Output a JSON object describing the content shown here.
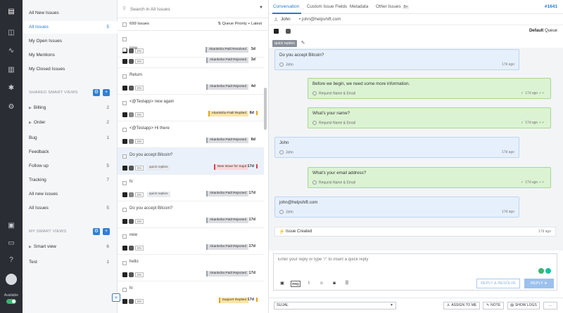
{
  "rail": {
    "available_label": "Available"
  },
  "views": {
    "top_items": [
      {
        "label": "All New Issues",
        "count": ""
      },
      {
        "label": "All Issues",
        "count": "5"
      },
      {
        "label": "My Open Issues",
        "count": ""
      },
      {
        "label": "My Mentions",
        "count": ""
      },
      {
        "label": "My Closed Issues",
        "count": ""
      }
    ],
    "shared_title": "SHARED SMART VIEWS",
    "shared_items": [
      {
        "label": "Billing",
        "count": "2"
      },
      {
        "label": "Order",
        "count": "2"
      },
      {
        "label": "Bug",
        "count": "1"
      },
      {
        "label": "Feedback",
        "count": ""
      },
      {
        "label": "Follow up",
        "count": "5"
      },
      {
        "label": "Tracking",
        "count": "7"
      },
      {
        "label": "All new issues",
        "count": ""
      },
      {
        "label": "All Issues",
        "count": "5"
      }
    ],
    "my_title": "MY SMART VIEWS",
    "my_items": [
      {
        "label": "Smart view",
        "count": "6"
      },
      {
        "label": "Test",
        "count": "1"
      }
    ]
  },
  "issues": {
    "search_placeholder": "Search in All Issues",
    "total_label": "699 Issues",
    "sort_label": "Queue Priority + Latest",
    "en_tag": "EN",
    "items": [
      {
        "title": "",
        "tag": "",
        "assignee": "Akanksha Patil Resolved",
        "age": "3d"
      },
      {
        "title": "new",
        "tag": "",
        "assignee": "Akanksha Patil Rejected",
        "age": "3d"
      },
      {
        "title": "Return",
        "tag": "",
        "assignee": "Akanksha Patil Rejected",
        "age": "4d"
      },
      {
        "title": "<@Testapp> new again",
        "tag": "",
        "assignee": "Akanksha Patil Replied",
        "age": "8d"
      },
      {
        "title": "<@Testapp> Hi there",
        "tag": "",
        "assignee": "Akanksha Patil Rejected",
        "age": "8d"
      },
      {
        "title": "Do you accept Bitcoin?",
        "tag": "quick replies",
        "assignee": "New Issue for Sujal",
        "age": "17d"
      },
      {
        "title": "hi",
        "tag": "quick replies",
        "assignee": "Akanksha Patil Rejected",
        "age": "17d"
      },
      {
        "title": "Do you accept Bitcoin?",
        "tag": "",
        "assignee": "Akanksha Patil Rejected",
        "age": "17d"
      },
      {
        "title": "new",
        "tag": "",
        "assignee": "Akanksha Patil Rejected",
        "age": "17d"
      },
      {
        "title": "hello",
        "tag": "",
        "assignee": "Akanksha Patil Rejected",
        "age": "17d"
      },
      {
        "title": "hi",
        "tag": "",
        "assignee": "Support Replied",
        "age": "17d"
      }
    ]
  },
  "conversation": {
    "tabs": [
      "Conversation",
      "Custom Issue Fields",
      "Metadata",
      "Other Issues"
    ],
    "other_issues_badge": "5+",
    "issue_id": "#1641",
    "customer_name": "John",
    "customer_email": "john@helpshift.com",
    "queue_value": "Default",
    "queue_label": "Queue",
    "tag_chip": "quick replies",
    "messages": [
      {
        "text": "Do you accept Bitcoin?",
        "from": "John",
        "time": "17d ago"
      },
      {
        "text": "Before we begin, we need some more information.",
        "from": "Request Name & Email",
        "time": "17d ago"
      },
      {
        "text": "What's your name?",
        "from": "Request Name & Email",
        "time": "17d ago"
      },
      {
        "text": "John",
        "from": "John",
        "time": "17d ago"
      },
      {
        "text": "What's your email address?",
        "from": "Request Name & Email",
        "time": "17d ago"
      },
      {
        "text": "john@helpshift.com",
        "from": "John",
        "time": "17d ago"
      }
    ],
    "system_event": "Issue Created",
    "system_time": "17d ago",
    "reply_placeholder": "Enter your reply or type \"/\" to insert a quick reply",
    "faq_label": "FAQ",
    "reply_resolve_label": "REPLY & RESOLVE",
    "reply_label": "REPLY",
    "assignee_value": "SUJAL",
    "assign_to_me_label": "ASSIGN TO ME",
    "note_label": "NOTE",
    "show_logs_label": "SHOW LOGS",
    "more_label": "..."
  }
}
